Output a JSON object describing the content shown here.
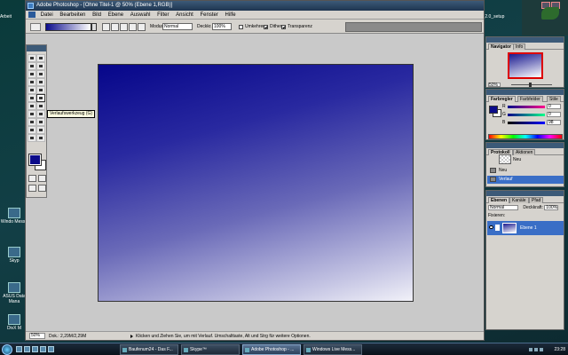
{
  "window": {
    "title": "Adobe Photoshop - [Ohne Titel-1 @ 50% (Ebene 1,RGB)]"
  },
  "menu": [
    "Datei",
    "Bearbeiten",
    "Bild",
    "Ebene",
    "Auswahl",
    "Filter",
    "Ansicht",
    "Fenster",
    "Hilfe"
  ],
  "options_bar": {
    "modus_label": "Modus:",
    "modus_value": "Normal",
    "deckkraft_label": "Deckkr.:",
    "deckkraft_value": "100%",
    "umkehren_label": "Umkehren",
    "dither_label": "Dither",
    "transparenz_label": "Transparenz",
    "umkehren_checked": false,
    "dither_checked": true,
    "transparenz_checked": true
  },
  "tooltip": "Verlaufswerkzeug (G)",
  "status_bar": {
    "zoom": "50%",
    "doc_info": "Dok.: 2,29M/2,29M",
    "hint": "Klicken und Ziehen Sie, um mit Verlauf. Umschalttaste, Alt und Strg für weitere Optionen."
  },
  "navigator": {
    "tabs": [
      "Navigator",
      "Info"
    ],
    "zoom": "50%"
  },
  "color_panel": {
    "tabs": [
      "Farbregler",
      "Farbfelder",
      "Stile"
    ],
    "channels": [
      {
        "label": "R",
        "value": "0"
      },
      {
        "label": "G",
        "value": "0"
      },
      {
        "label": "B",
        "value": "98"
      }
    ],
    "foreground": "#0b0b8a",
    "background": "#ffffff"
  },
  "history": {
    "tabs": [
      "Protokoll",
      "Aktionen"
    ],
    "snapshot": "Neu",
    "items": [
      "Neu",
      "Verlauf"
    ]
  },
  "layers": {
    "tabs": [
      "Ebenen",
      "Kanäle",
      "Pfad"
    ],
    "mode": "Normal",
    "opacity_label": "Deckkraft:",
    "opacity_value": "100%",
    "lock_label": "Fixieren:",
    "layer_name": "Ebene 1"
  },
  "desktop": {
    "top_label": "Arbeit",
    "setup_label": "111_2.0_setup",
    "icons": [
      "Windo Messe",
      "Skyp",
      "ASUS Data Mana",
      "DivX M"
    ]
  },
  "taskbar": {
    "items": [
      "Baufenum24 - Das F...",
      "Skype™",
      "Adobe Photoshop - ...",
      "Windows Live Mess..."
    ],
    "clock": "23:28"
  }
}
